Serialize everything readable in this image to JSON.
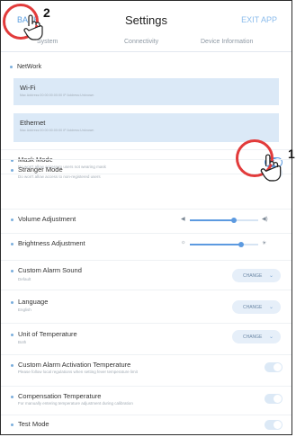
{
  "header": {
    "back_label": "BACK",
    "title": "Settings",
    "exit_label": "EXIT APP"
  },
  "tabs": [
    {
      "label": "System"
    },
    {
      "label": "Connectivity"
    },
    {
      "label": "Device Information"
    }
  ],
  "network": {
    "section_label": "NetWork",
    "wifi": {
      "name": "Wi-Fi",
      "meta": "Mac Address:00:00:00:00:00   IP Address:Unknown"
    },
    "ethernet": {
      "name": "Ethernet",
      "meta": "Mac Address:00:00:00:00:00   IP Address:Unknown"
    }
  },
  "settings": {
    "mask_mode": {
      "label": "Mask Mode",
      "desc": "Do won't allow access to users not wearing mask",
      "enabled": true
    },
    "stranger_mode": {
      "label": "Stranger Mode",
      "desc": "Do won't allow access to non-registered users",
      "enabled": false
    },
    "volume": {
      "label": "Volume Adjustment",
      "level": 0.65
    },
    "brightness": {
      "label": "Brightness Adjustment",
      "level": 0.75
    },
    "alarm_sound": {
      "label": "Custom Alarm Sound",
      "desc": "Default",
      "button": "CHANGE"
    },
    "language": {
      "label": "Language",
      "desc": "English",
      "button": "CHANGE"
    },
    "temp_unit": {
      "label": "Unit of Temperature",
      "desc": "Both",
      "button": "CHANGE"
    },
    "alarm_temp": {
      "label": "Custom Alarm Activation Temperature",
      "desc": "Please follow local regulations when setting fever temperature limit",
      "enabled": false
    },
    "compensation": {
      "label": "Compensation Temperature",
      "desc": "For manually entering temperature adjustment during calibration",
      "enabled": false
    },
    "test_mode": {
      "label": "Test Mode",
      "enabled": false
    }
  },
  "callouts": {
    "one": "1",
    "two": "2"
  },
  "colors": {
    "accent": "#5c9ae0",
    "callout_ring": "#e23b3b",
    "net_box": "#dbe9f7"
  }
}
